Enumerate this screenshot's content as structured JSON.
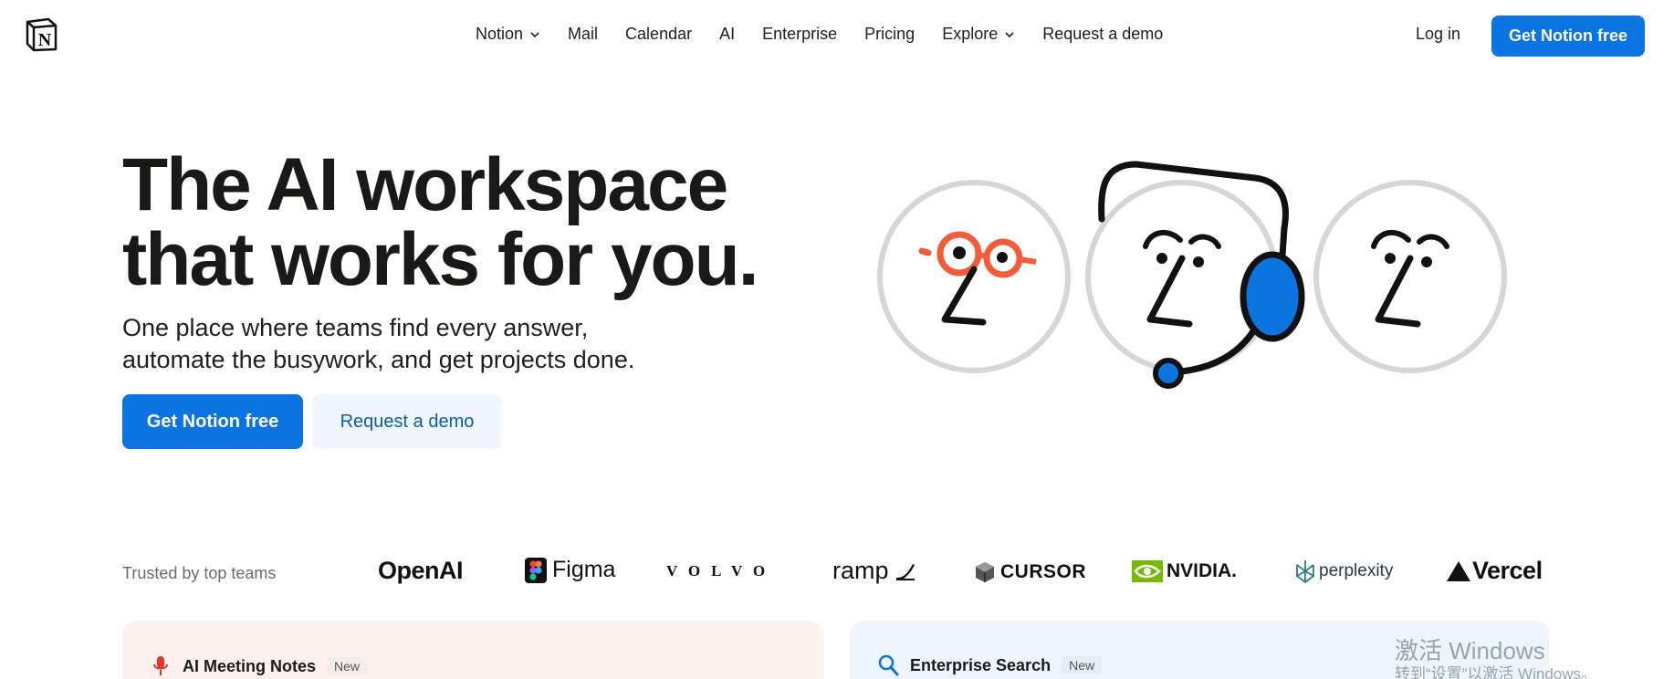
{
  "nav": {
    "logo_letter": "N",
    "links": [
      {
        "label": "Notion",
        "has_dropdown": true
      },
      {
        "label": "Mail",
        "has_dropdown": false
      },
      {
        "label": "Calendar",
        "has_dropdown": false
      },
      {
        "label": "AI",
        "has_dropdown": false
      },
      {
        "label": "Enterprise",
        "has_dropdown": false
      },
      {
        "label": "Pricing",
        "has_dropdown": false
      },
      {
        "label": "Explore",
        "has_dropdown": true
      },
      {
        "label": "Request a demo",
        "has_dropdown": false
      }
    ],
    "login_label": "Log in",
    "cta_label": "Get Notion free"
  },
  "hero": {
    "title_line1": "The AI workspace",
    "title_line2": "that works for you.",
    "subtitle_line1": "One place where teams find every answer,",
    "subtitle_line2": "automate the busywork, and get projects done.",
    "primary_button": "Get Notion free",
    "secondary_button": "Request a demo"
  },
  "trusted": {
    "label": "Trusted by top teams",
    "logos": [
      {
        "name": "OpenAI",
        "icon": "openai-wordmark"
      },
      {
        "name": "Figma",
        "icon": "figma-logo-icon"
      },
      {
        "name": "VOLVO",
        "icon": "volvo-wordmark"
      },
      {
        "name": "ramp",
        "icon": "ramp-logo-icon"
      },
      {
        "name": "CURSOR",
        "icon": "cursor-logo-icon"
      },
      {
        "name": "NVIDIA.",
        "icon": "nvidia-eye-icon"
      },
      {
        "name": "perplexity",
        "icon": "perplexity-logo-icon"
      },
      {
        "name": "Vercel",
        "icon": "vercel-triangle-icon"
      }
    ]
  },
  "cards": {
    "left": {
      "title": "AI Meeting Notes",
      "badge": "New",
      "icon": "microphone-icon"
    },
    "right": {
      "title": "Enterprise Search",
      "badge": "New",
      "icon": "search-icon"
    }
  },
  "watermark": {
    "line1": "激活 Windows",
    "line2": "转到“设置”以激活 Windows。"
  },
  "colors": {
    "brand_blue": "#0b74e0",
    "accent_orange": "#f25c3b",
    "left_card_bg": "#fdf1ef",
    "right_card_bg": "#eef5fc"
  }
}
